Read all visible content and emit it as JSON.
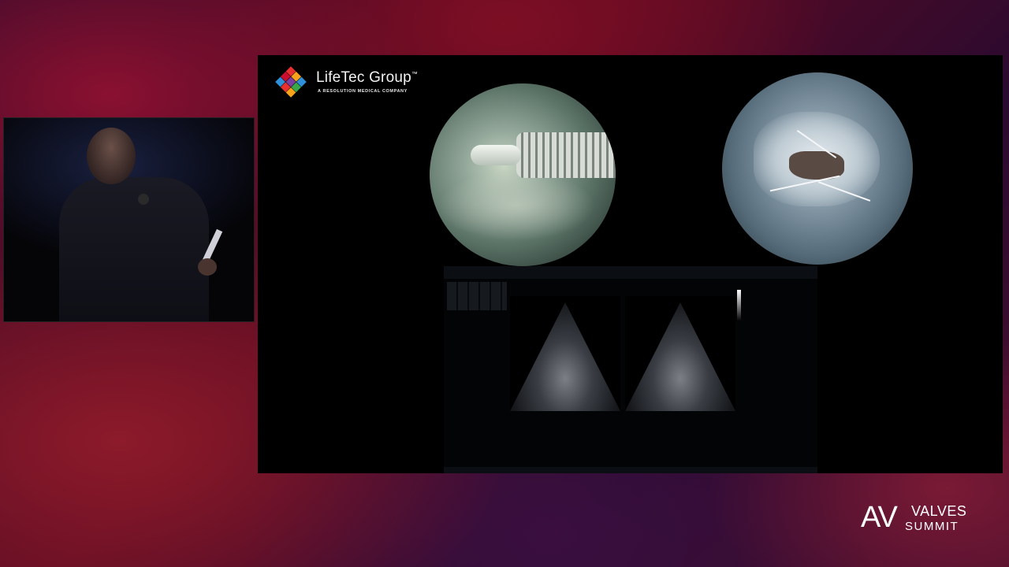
{
  "speaker_video": {
    "description_icon": "speaker-video-feed"
  },
  "slide": {
    "logo": {
      "name": "LifeTec Group",
      "trademark": "™",
      "tagline": "A RESOLUTION MEDICAL COMPANY",
      "colors": [
        "#e8312f",
        "#f7a21b",
        "#2f8fd8",
        "#3aa64a",
        "#7a3fa0",
        "#c8102e"
      ]
    },
    "echo_monitor": {
      "header_left": "",
      "header_center": "",
      "header_right": ""
    }
  },
  "brand": {
    "av": "AV",
    "valves": "VALVES",
    "summit": "SUMMIT"
  }
}
